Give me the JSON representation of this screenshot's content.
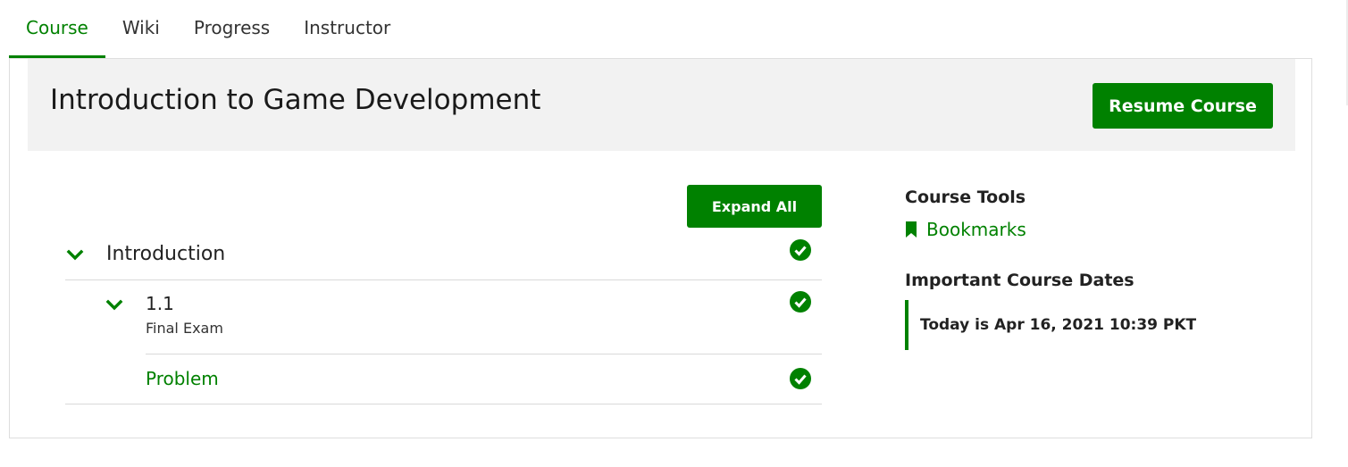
{
  "tabs": [
    {
      "label": "Course",
      "active": true
    },
    {
      "label": "Wiki",
      "active": false
    },
    {
      "label": "Progress",
      "active": false
    },
    {
      "label": "Instructor",
      "active": false
    }
  ],
  "header": {
    "course_title": "Introduction to Game Development",
    "resume_label": "Resume Course"
  },
  "outline": {
    "expand_label": "Expand All",
    "section": {
      "title": "Introduction",
      "completed": true,
      "icon": "chevron-down-icon"
    },
    "subsection": {
      "number": "1.1",
      "title": "Final Exam",
      "completed": true,
      "icon": "chevron-down-icon"
    },
    "unit": {
      "title": "Problem",
      "completed": true
    }
  },
  "sidebar": {
    "tools_heading": "Course Tools",
    "bookmarks_label": "Bookmarks",
    "dates_heading": "Important Course Dates",
    "today_text": "Today is Apr 16, 2021 10:39 PKT"
  },
  "colors": {
    "accent": "#008100",
    "band": "#f2f2f2",
    "divider": "#d9d9d9"
  }
}
